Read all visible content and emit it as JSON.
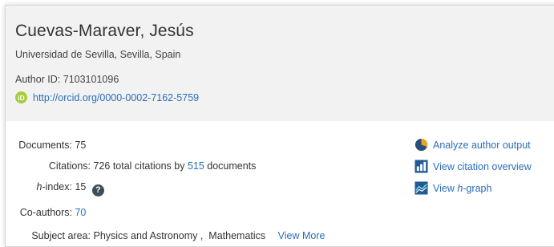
{
  "author": {
    "name": "Cuevas-Maraver, Jesús",
    "affiliation": "Universidad de Sevilla, Sevilla, Spain",
    "author_id": "Author ID: 7103101096",
    "orcid_badge": "iD",
    "orcid_url": "http://orcid.org/0000-0002-7162-5759"
  },
  "metrics": {
    "documents_label": "Documents:",
    "documents_value": "75",
    "citations_label": "Citations:",
    "citations_prefix": "726 total citations by",
    "citations_docs_link": "515",
    "citations_suffix": "documents",
    "hindex_label_italic": "h",
    "hindex_label_rest": "-index:",
    "hindex_value": "15",
    "help_glyph": "?",
    "coauthors_label": "Co-authors:",
    "coauthors_value": "70",
    "subject_label": "Subject area:",
    "subject_values": "Physics and Astronomy ,  Mathematics",
    "view_more": "View More"
  },
  "actions": {
    "analyze": "Analyze author output",
    "citation_overview": "View citation overview",
    "hgraph_prefix": "View",
    "hgraph_italic": "h",
    "hgraph_suffix": "-graph"
  },
  "icons": {
    "orcid": "orcid-icon",
    "help": "help-icon",
    "analyze": "pie-chart-icon",
    "citation_overview": "bar-chart-icon",
    "hgraph": "line-graph-icon"
  },
  "colors": {
    "link": "#2a6ebb",
    "orcid_green": "#a6ce39",
    "header_bg": "#f2f2f2"
  }
}
